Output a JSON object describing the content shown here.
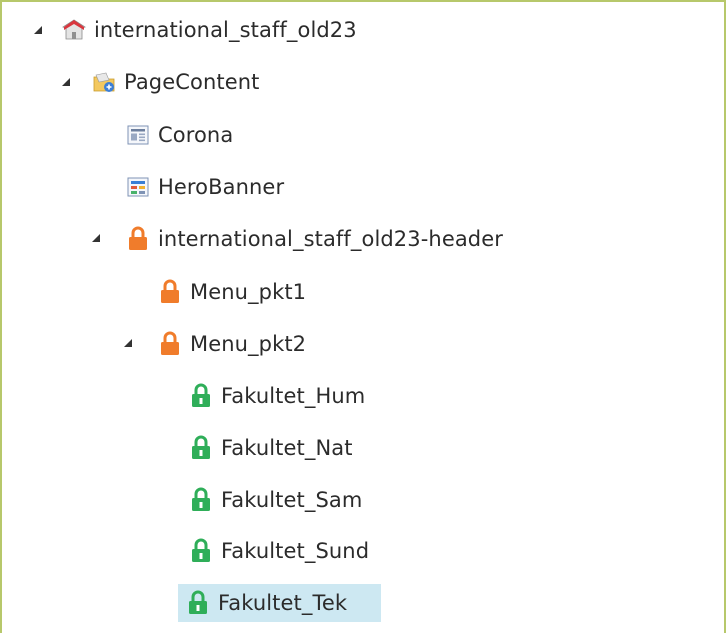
{
  "tree": {
    "nodes": [
      {
        "label": "international_staff_old23",
        "icon": "house-icon",
        "expanded": true,
        "selected": false
      },
      {
        "label": "PageContent",
        "icon": "folder-icon",
        "expanded": true,
        "selected": false
      },
      {
        "label": "Corona",
        "icon": "content-item-icon",
        "selected": false
      },
      {
        "label": "HeroBanner",
        "icon": "banner-item-icon",
        "selected": false
      },
      {
        "label": "international_staff_old23-header",
        "icon": "orange-lock-icon",
        "expanded": true,
        "selected": false
      },
      {
        "label": "Menu_pkt1",
        "icon": "orange-lock-icon",
        "selected": false
      },
      {
        "label": "Menu_pkt2",
        "icon": "orange-lock-icon",
        "expanded": true,
        "selected": false
      },
      {
        "label": "Fakultet_Hum",
        "icon": "green-lock-icon",
        "selected": false
      },
      {
        "label": "Fakultet_Nat",
        "icon": "green-lock-icon",
        "selected": false
      },
      {
        "label": "Fakultet_Sam",
        "icon": "green-lock-icon",
        "selected": false
      },
      {
        "label": "Fakultet_Sund",
        "icon": "green-lock-icon",
        "selected": false
      },
      {
        "label": "Fakultet_Tek",
        "icon": "green-lock-icon",
        "selected": true
      }
    ]
  },
  "colors": {
    "border": "#b7c86b",
    "selection": "#cde8f2",
    "text": "#2b2b2b",
    "orange_lock": "#f07c2b",
    "green_lock": "#2fae59"
  }
}
